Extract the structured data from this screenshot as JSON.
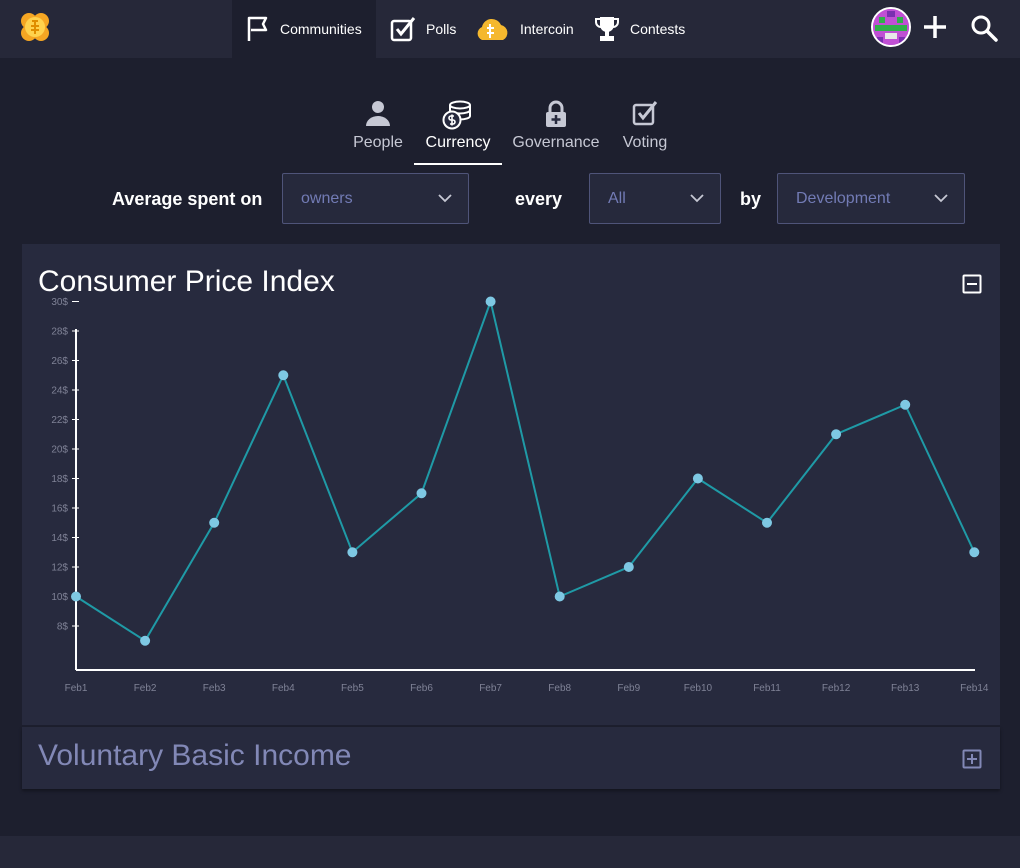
{
  "nav": {
    "tabs": [
      {
        "label": "Communities",
        "icon": "flag-icon",
        "active": true
      },
      {
        "label": "Polls",
        "icon": "checkbox-icon",
        "active": false
      },
      {
        "label": "Intercoin",
        "icon": "cloud-coin-icon",
        "active": false
      },
      {
        "label": "Contests",
        "icon": "trophy-icon",
        "active": false
      }
    ]
  },
  "subtabs": [
    {
      "label": "People",
      "icon": "person-icon",
      "active": false
    },
    {
      "label": "Currency",
      "icon": "coins-icon",
      "active": true
    },
    {
      "label": "Governance",
      "icon": "lock-icon",
      "active": false
    },
    {
      "label": "Voting",
      "icon": "checkbox-icon",
      "active": false
    }
  ],
  "filters": {
    "label_average": "Average spent on",
    "label_every": "every",
    "label_by": "by",
    "spent_on": "owners",
    "every": "All",
    "by": "Development"
  },
  "panels": {
    "cpi_title": "Consumer Price Index",
    "vbi_title": "Voluntary Basic Income"
  },
  "colors": {
    "accent_line": "#1f9aa6",
    "point": "#7ec8e3",
    "axis": "#ffffff",
    "tick_text": "#7f8296"
  },
  "chart_data": {
    "type": "line",
    "categories": [
      "Feb1",
      "Feb2",
      "Feb3",
      "Feb4",
      "Feb5",
      "Feb6",
      "Feb7",
      "Feb8",
      "Feb9",
      "Feb10",
      "Feb11",
      "Feb12",
      "Feb13",
      "Feb14"
    ],
    "values": [
      10,
      7,
      15,
      25,
      13,
      17,
      30,
      10,
      12,
      18,
      15,
      21,
      23,
      13
    ],
    "yticks": [
      "8$",
      "10$",
      "12$",
      "14$",
      "16$",
      "18$",
      "20$",
      "22$",
      "24$",
      "26$",
      "28$",
      "30$"
    ],
    "ylim": [
      7,
      30
    ],
    "grid": false
  }
}
